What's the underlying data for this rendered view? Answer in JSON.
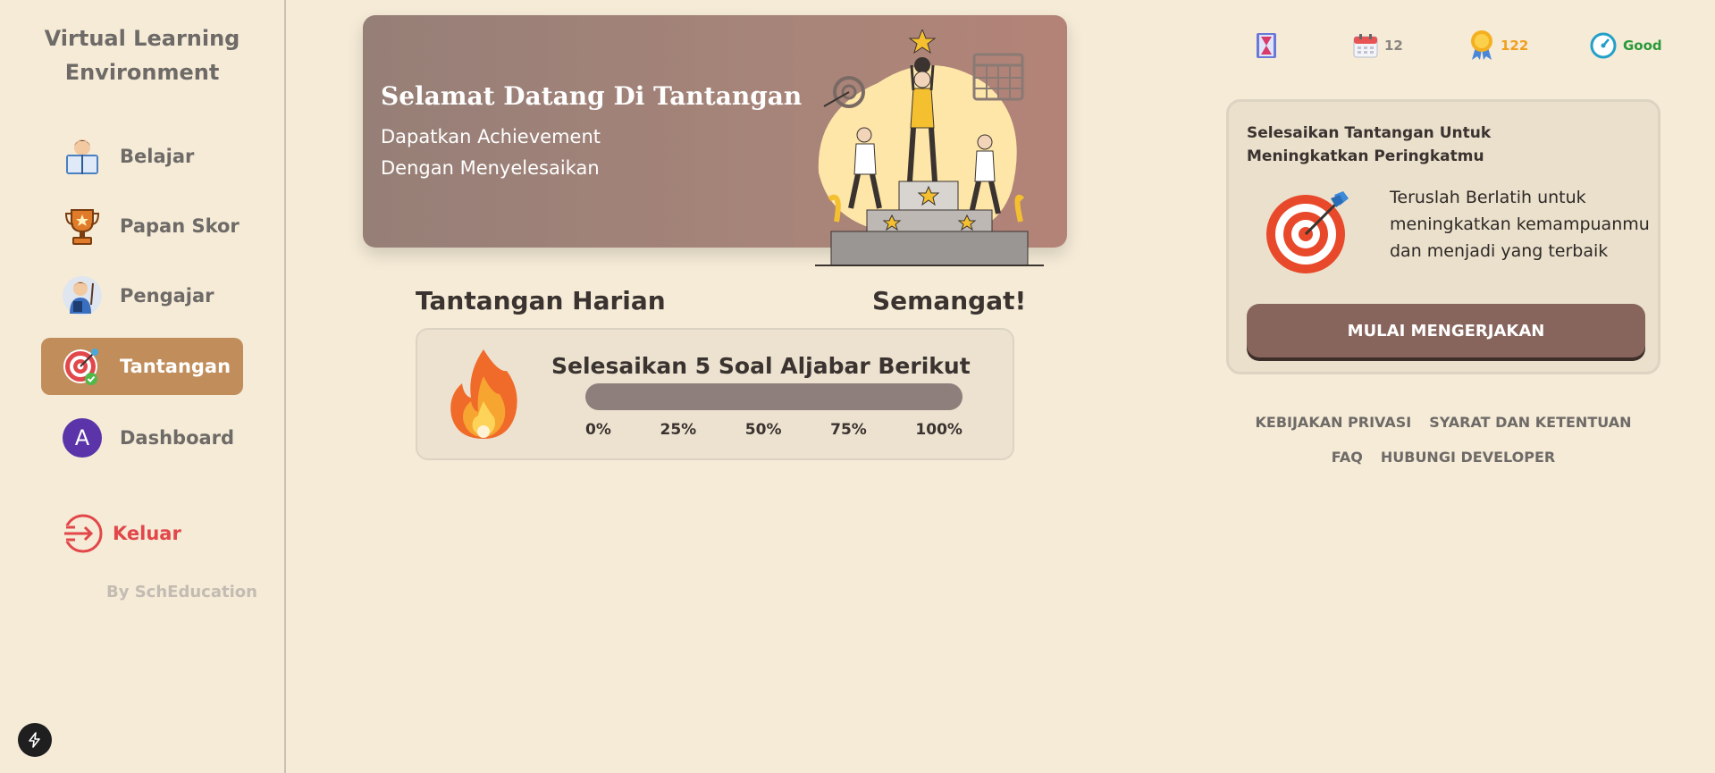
{
  "sidebar": {
    "brand_line1": "Virtual Learning",
    "brand_line2": "Environment",
    "items": [
      {
        "label": "Belajar"
      },
      {
        "label": "Papan Skor"
      },
      {
        "label": "Pengajar"
      },
      {
        "label": "Tantangan"
      },
      {
        "label": "Dashboard"
      }
    ],
    "avatar_letter": "A",
    "logout_label": "Keluar",
    "byline": "By SchEducation"
  },
  "banner": {
    "title": "Selamat Datang Di Tantangan",
    "line1": "Dapatkan Achievement",
    "line2": "Dengan Menyelesaikan"
  },
  "daily": {
    "title": "Tantangan Harian",
    "cheer": "Semangat!",
    "task_title": "Selesaikan 5 Soal Aljabar Berikut",
    "progress_ticks": [
      "0%",
      "25%",
      "50%",
      "75%",
      "100%"
    ],
    "progress_value": 0
  },
  "stats": {
    "days": "12",
    "points": "122",
    "status": "Good"
  },
  "rank_card": {
    "title_line1": "Selesaikan Tantangan Untuk",
    "title_line2": "Meningkatkan Peringkatmu",
    "desc_line1": "Teruslah Berlatih untuk",
    "desc_line2": "meningkatkan kemampuanmu",
    "desc_line3": "dan menjadi yang terbaik",
    "button_label": "MULAI MENGERJAKAN"
  },
  "footer": {
    "privacy": "KEBIJAKAN PRIVASI",
    "terms": "SYARAT DAN KETENTUAN",
    "faq": "FAQ",
    "contact": "HUBUNGI DEVELOPER"
  },
  "colors": {
    "background": "#f5ebd7",
    "active_nav": "#c08d5b",
    "logout": "#e2474a",
    "button": "#87655d",
    "points": "#f0a020",
    "status": "#2a9a3a"
  }
}
